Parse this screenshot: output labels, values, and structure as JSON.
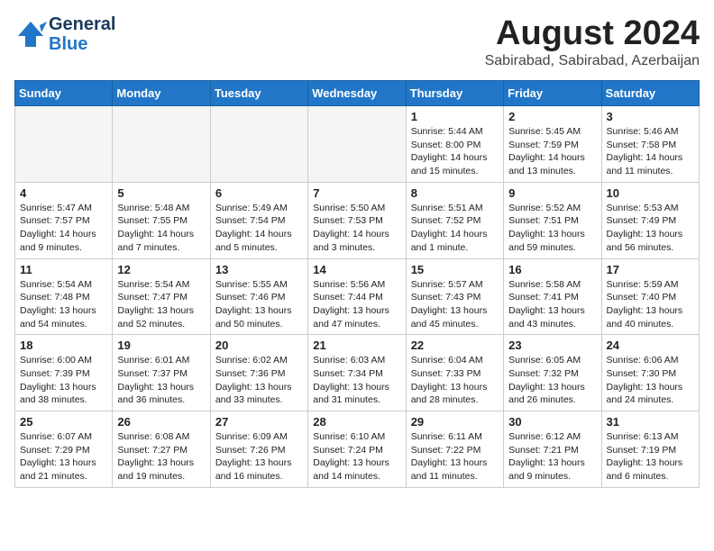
{
  "header": {
    "logo_line1": "General",
    "logo_line2": "Blue",
    "month_title": "August 2024",
    "location": "Sabirabad, Sabirabad, Azerbaijan"
  },
  "weekdays": [
    "Sunday",
    "Monday",
    "Tuesday",
    "Wednesday",
    "Thursday",
    "Friday",
    "Saturday"
  ],
  "weeks": [
    [
      {
        "day": "",
        "detail": ""
      },
      {
        "day": "",
        "detail": ""
      },
      {
        "day": "",
        "detail": ""
      },
      {
        "day": "",
        "detail": ""
      },
      {
        "day": "1",
        "detail": "Sunrise: 5:44 AM\nSunset: 8:00 PM\nDaylight: 14 hours\nand 15 minutes."
      },
      {
        "day": "2",
        "detail": "Sunrise: 5:45 AM\nSunset: 7:59 PM\nDaylight: 14 hours\nand 13 minutes."
      },
      {
        "day": "3",
        "detail": "Sunrise: 5:46 AM\nSunset: 7:58 PM\nDaylight: 14 hours\nand 11 minutes."
      }
    ],
    [
      {
        "day": "4",
        "detail": "Sunrise: 5:47 AM\nSunset: 7:57 PM\nDaylight: 14 hours\nand 9 minutes."
      },
      {
        "day": "5",
        "detail": "Sunrise: 5:48 AM\nSunset: 7:55 PM\nDaylight: 14 hours\nand 7 minutes."
      },
      {
        "day": "6",
        "detail": "Sunrise: 5:49 AM\nSunset: 7:54 PM\nDaylight: 14 hours\nand 5 minutes."
      },
      {
        "day": "7",
        "detail": "Sunrise: 5:50 AM\nSunset: 7:53 PM\nDaylight: 14 hours\nand 3 minutes."
      },
      {
        "day": "8",
        "detail": "Sunrise: 5:51 AM\nSunset: 7:52 PM\nDaylight: 14 hours\nand 1 minute."
      },
      {
        "day": "9",
        "detail": "Sunrise: 5:52 AM\nSunset: 7:51 PM\nDaylight: 13 hours\nand 59 minutes."
      },
      {
        "day": "10",
        "detail": "Sunrise: 5:53 AM\nSunset: 7:49 PM\nDaylight: 13 hours\nand 56 minutes."
      }
    ],
    [
      {
        "day": "11",
        "detail": "Sunrise: 5:54 AM\nSunset: 7:48 PM\nDaylight: 13 hours\nand 54 minutes."
      },
      {
        "day": "12",
        "detail": "Sunrise: 5:54 AM\nSunset: 7:47 PM\nDaylight: 13 hours\nand 52 minutes."
      },
      {
        "day": "13",
        "detail": "Sunrise: 5:55 AM\nSunset: 7:46 PM\nDaylight: 13 hours\nand 50 minutes."
      },
      {
        "day": "14",
        "detail": "Sunrise: 5:56 AM\nSunset: 7:44 PM\nDaylight: 13 hours\nand 47 minutes."
      },
      {
        "day": "15",
        "detail": "Sunrise: 5:57 AM\nSunset: 7:43 PM\nDaylight: 13 hours\nand 45 minutes."
      },
      {
        "day": "16",
        "detail": "Sunrise: 5:58 AM\nSunset: 7:41 PM\nDaylight: 13 hours\nand 43 minutes."
      },
      {
        "day": "17",
        "detail": "Sunrise: 5:59 AM\nSunset: 7:40 PM\nDaylight: 13 hours\nand 40 minutes."
      }
    ],
    [
      {
        "day": "18",
        "detail": "Sunrise: 6:00 AM\nSunset: 7:39 PM\nDaylight: 13 hours\nand 38 minutes."
      },
      {
        "day": "19",
        "detail": "Sunrise: 6:01 AM\nSunset: 7:37 PM\nDaylight: 13 hours\nand 36 minutes."
      },
      {
        "day": "20",
        "detail": "Sunrise: 6:02 AM\nSunset: 7:36 PM\nDaylight: 13 hours\nand 33 minutes."
      },
      {
        "day": "21",
        "detail": "Sunrise: 6:03 AM\nSunset: 7:34 PM\nDaylight: 13 hours\nand 31 minutes."
      },
      {
        "day": "22",
        "detail": "Sunrise: 6:04 AM\nSunset: 7:33 PM\nDaylight: 13 hours\nand 28 minutes."
      },
      {
        "day": "23",
        "detail": "Sunrise: 6:05 AM\nSunset: 7:32 PM\nDaylight: 13 hours\nand 26 minutes."
      },
      {
        "day": "24",
        "detail": "Sunrise: 6:06 AM\nSunset: 7:30 PM\nDaylight: 13 hours\nand 24 minutes."
      }
    ],
    [
      {
        "day": "25",
        "detail": "Sunrise: 6:07 AM\nSunset: 7:29 PM\nDaylight: 13 hours\nand 21 minutes."
      },
      {
        "day": "26",
        "detail": "Sunrise: 6:08 AM\nSunset: 7:27 PM\nDaylight: 13 hours\nand 19 minutes."
      },
      {
        "day": "27",
        "detail": "Sunrise: 6:09 AM\nSunset: 7:26 PM\nDaylight: 13 hours\nand 16 minutes."
      },
      {
        "day": "28",
        "detail": "Sunrise: 6:10 AM\nSunset: 7:24 PM\nDaylight: 13 hours\nand 14 minutes."
      },
      {
        "day": "29",
        "detail": "Sunrise: 6:11 AM\nSunset: 7:22 PM\nDaylight: 13 hours\nand 11 minutes."
      },
      {
        "day": "30",
        "detail": "Sunrise: 6:12 AM\nSunset: 7:21 PM\nDaylight: 13 hours\nand 9 minutes."
      },
      {
        "day": "31",
        "detail": "Sunrise: 6:13 AM\nSunset: 7:19 PM\nDaylight: 13 hours\nand 6 minutes."
      }
    ]
  ]
}
